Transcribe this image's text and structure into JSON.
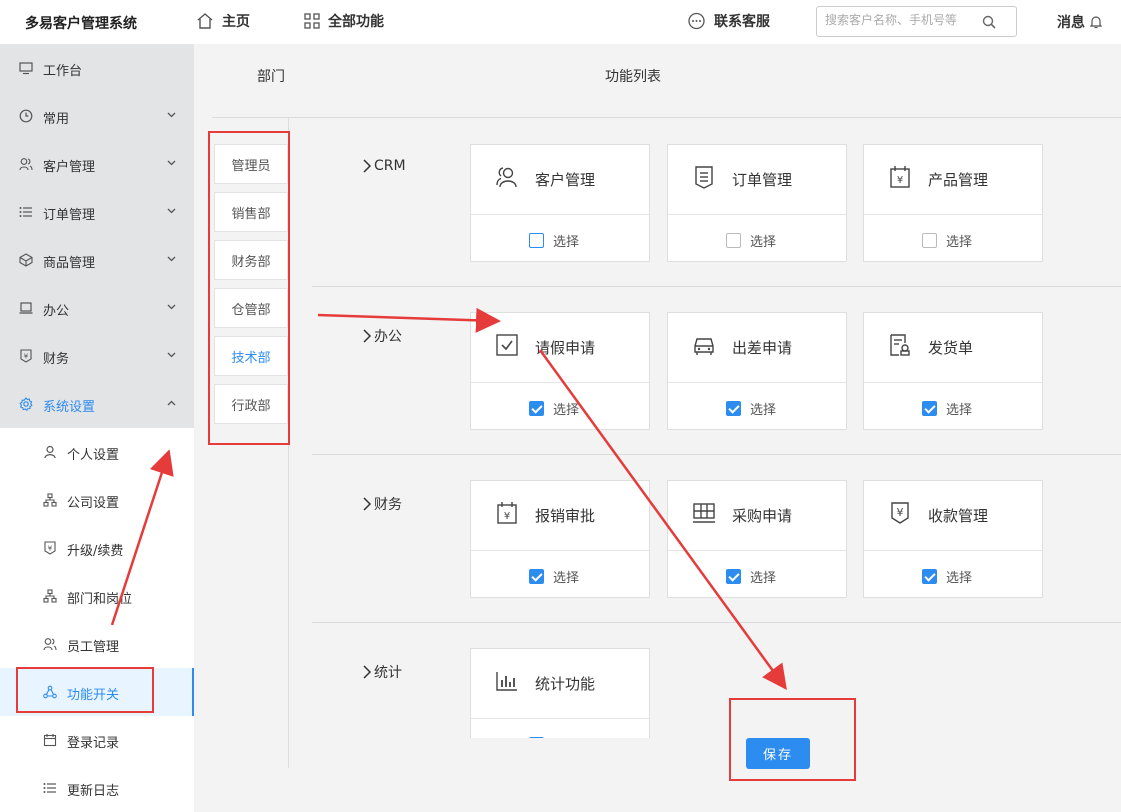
{
  "app": {
    "title": "多易客户管理系统"
  },
  "topnav": {
    "home": "主页",
    "all_features": "全部功能",
    "support": "联系客服",
    "messages": "消息"
  },
  "search": {
    "placeholder": "搜索客户名称、手机号等"
  },
  "sidebar": {
    "items": [
      {
        "label": "工作台",
        "icon": "monitor-icon"
      },
      {
        "label": "常用",
        "icon": "clock-icon"
      },
      {
        "label": "客户管理",
        "icon": "users-icon"
      },
      {
        "label": "订单管理",
        "icon": "list-icon"
      },
      {
        "label": "商品管理",
        "icon": "box-icon"
      },
      {
        "label": "办公",
        "icon": "laptop-icon"
      },
      {
        "label": "财务",
        "icon": "yen-icon"
      },
      {
        "label": "系统设置",
        "icon": "gear-icon",
        "active": true
      }
    ],
    "sub_items": [
      {
        "label": "个人设置",
        "icon": "user-icon"
      },
      {
        "label": "公司设置",
        "icon": "org-icon"
      },
      {
        "label": "升级/续费",
        "icon": "yen-icon"
      },
      {
        "label": "部门和岗位",
        "icon": "org-icon"
      },
      {
        "label": "员工管理",
        "icon": "users-icon"
      },
      {
        "label": "功能开关",
        "icon": "share-icon",
        "active": true
      },
      {
        "label": "登录记录",
        "icon": "calendar-icon"
      },
      {
        "label": "更新日志",
        "icon": "list-icon"
      }
    ]
  },
  "headers": {
    "dept": "部门",
    "features": "功能列表"
  },
  "departments": [
    {
      "label": "管理员"
    },
    {
      "label": "销售部"
    },
    {
      "label": "财务部"
    },
    {
      "label": "仓管部"
    },
    {
      "label": "技术部",
      "active": true
    },
    {
      "label": "行政部"
    }
  ],
  "select_label": "选择",
  "categories": [
    {
      "label": "CRM",
      "cards": [
        {
          "name": "客户管理",
          "icon": "users-icon",
          "checked": false,
          "highlight": true
        },
        {
          "name": "订单管理",
          "icon": "document-icon",
          "checked": false
        },
        {
          "name": "产品管理",
          "icon": "calendar-yen-icon",
          "checked": false
        }
      ]
    },
    {
      "label": "办公",
      "cards": [
        {
          "name": "请假申请",
          "icon": "checkbox-icon",
          "checked": true
        },
        {
          "name": "出差申请",
          "icon": "car-icon",
          "checked": true
        },
        {
          "name": "发货单",
          "icon": "receipt-icon",
          "checked": true
        }
      ]
    },
    {
      "label": "财务",
      "cards": [
        {
          "name": "报销审批",
          "icon": "calendar-yen-icon",
          "checked": true
        },
        {
          "name": "采购申请",
          "icon": "grid-icon",
          "checked": true
        },
        {
          "name": "收款管理",
          "icon": "shield-yen-icon",
          "checked": true
        }
      ]
    },
    {
      "label": "统计",
      "cards": [
        {
          "name": "统计功能",
          "icon": "bar-chart-icon",
          "checked": true
        }
      ]
    }
  ],
  "save_label": "保存",
  "colors": {
    "accent": "#2d8cf0",
    "annotation": "#e63b3b",
    "sidebar_bg": "#e3e4e6"
  }
}
